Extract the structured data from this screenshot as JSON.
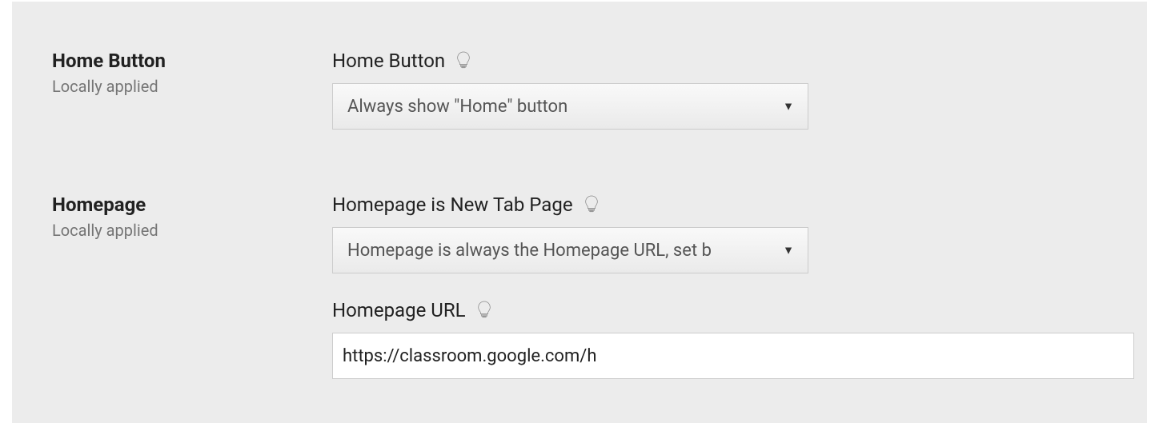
{
  "settings": {
    "homeButton": {
      "title": "Home Button",
      "scope": "Locally applied",
      "fieldLabel": "Home Button",
      "selected": "Always show \"Home\" button"
    },
    "homepage": {
      "title": "Homepage",
      "scope": "Locally applied",
      "newTabLabel": "Homepage is New Tab Page",
      "newTabSelected": "Homepage is always the Homepage URL, set b",
      "urlLabel": "Homepage URL",
      "urlValue": "https://classroom.google.com/h"
    }
  }
}
